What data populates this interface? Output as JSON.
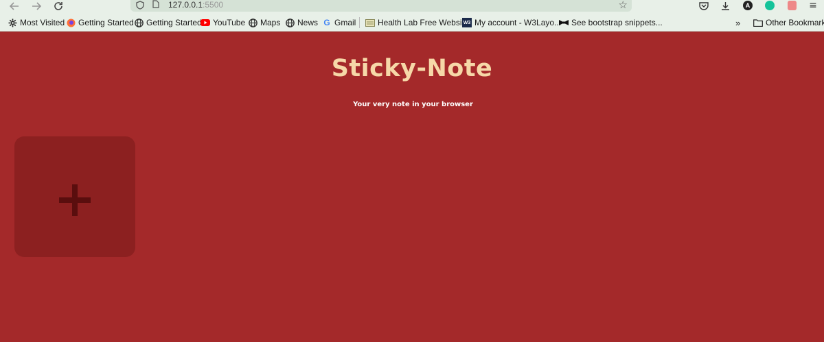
{
  "browser": {
    "url_host": "127.0.0.1",
    "url_port": ":5500",
    "bookmarks": [
      {
        "label": "Most Visited",
        "icon": "gear-icon"
      },
      {
        "label": "Getting Started",
        "icon": "firefox-icon"
      },
      {
        "label": "Getting Started",
        "icon": "globe-icon"
      },
      {
        "label": "YouTube",
        "icon": "youtube-icon"
      },
      {
        "label": "Maps",
        "icon": "globe-icon"
      },
      {
        "label": "News",
        "icon": "globe-icon"
      },
      {
        "label": "Gmail",
        "icon": "google-icon"
      },
      {
        "label": "Health Lab Free Websi...",
        "icon": "site-icon"
      },
      {
        "label": "My account - W3Layo...",
        "icon": "w3-icon"
      },
      {
        "label": "See bootstrap snippets...",
        "icon": "bowtie-icon"
      }
    ],
    "other_bookmarks": "Other Bookmarks",
    "profile_initial": "A",
    "w3_badge": "W3"
  },
  "app": {
    "title": "Sticky-Note",
    "subtitle": "Your very note in your browser",
    "add_button_symbol": "+"
  },
  "colors": {
    "background": "#a4292a",
    "title": "#f6d8a8",
    "card": "#8c2020",
    "plus": "#5a0e0e"
  }
}
